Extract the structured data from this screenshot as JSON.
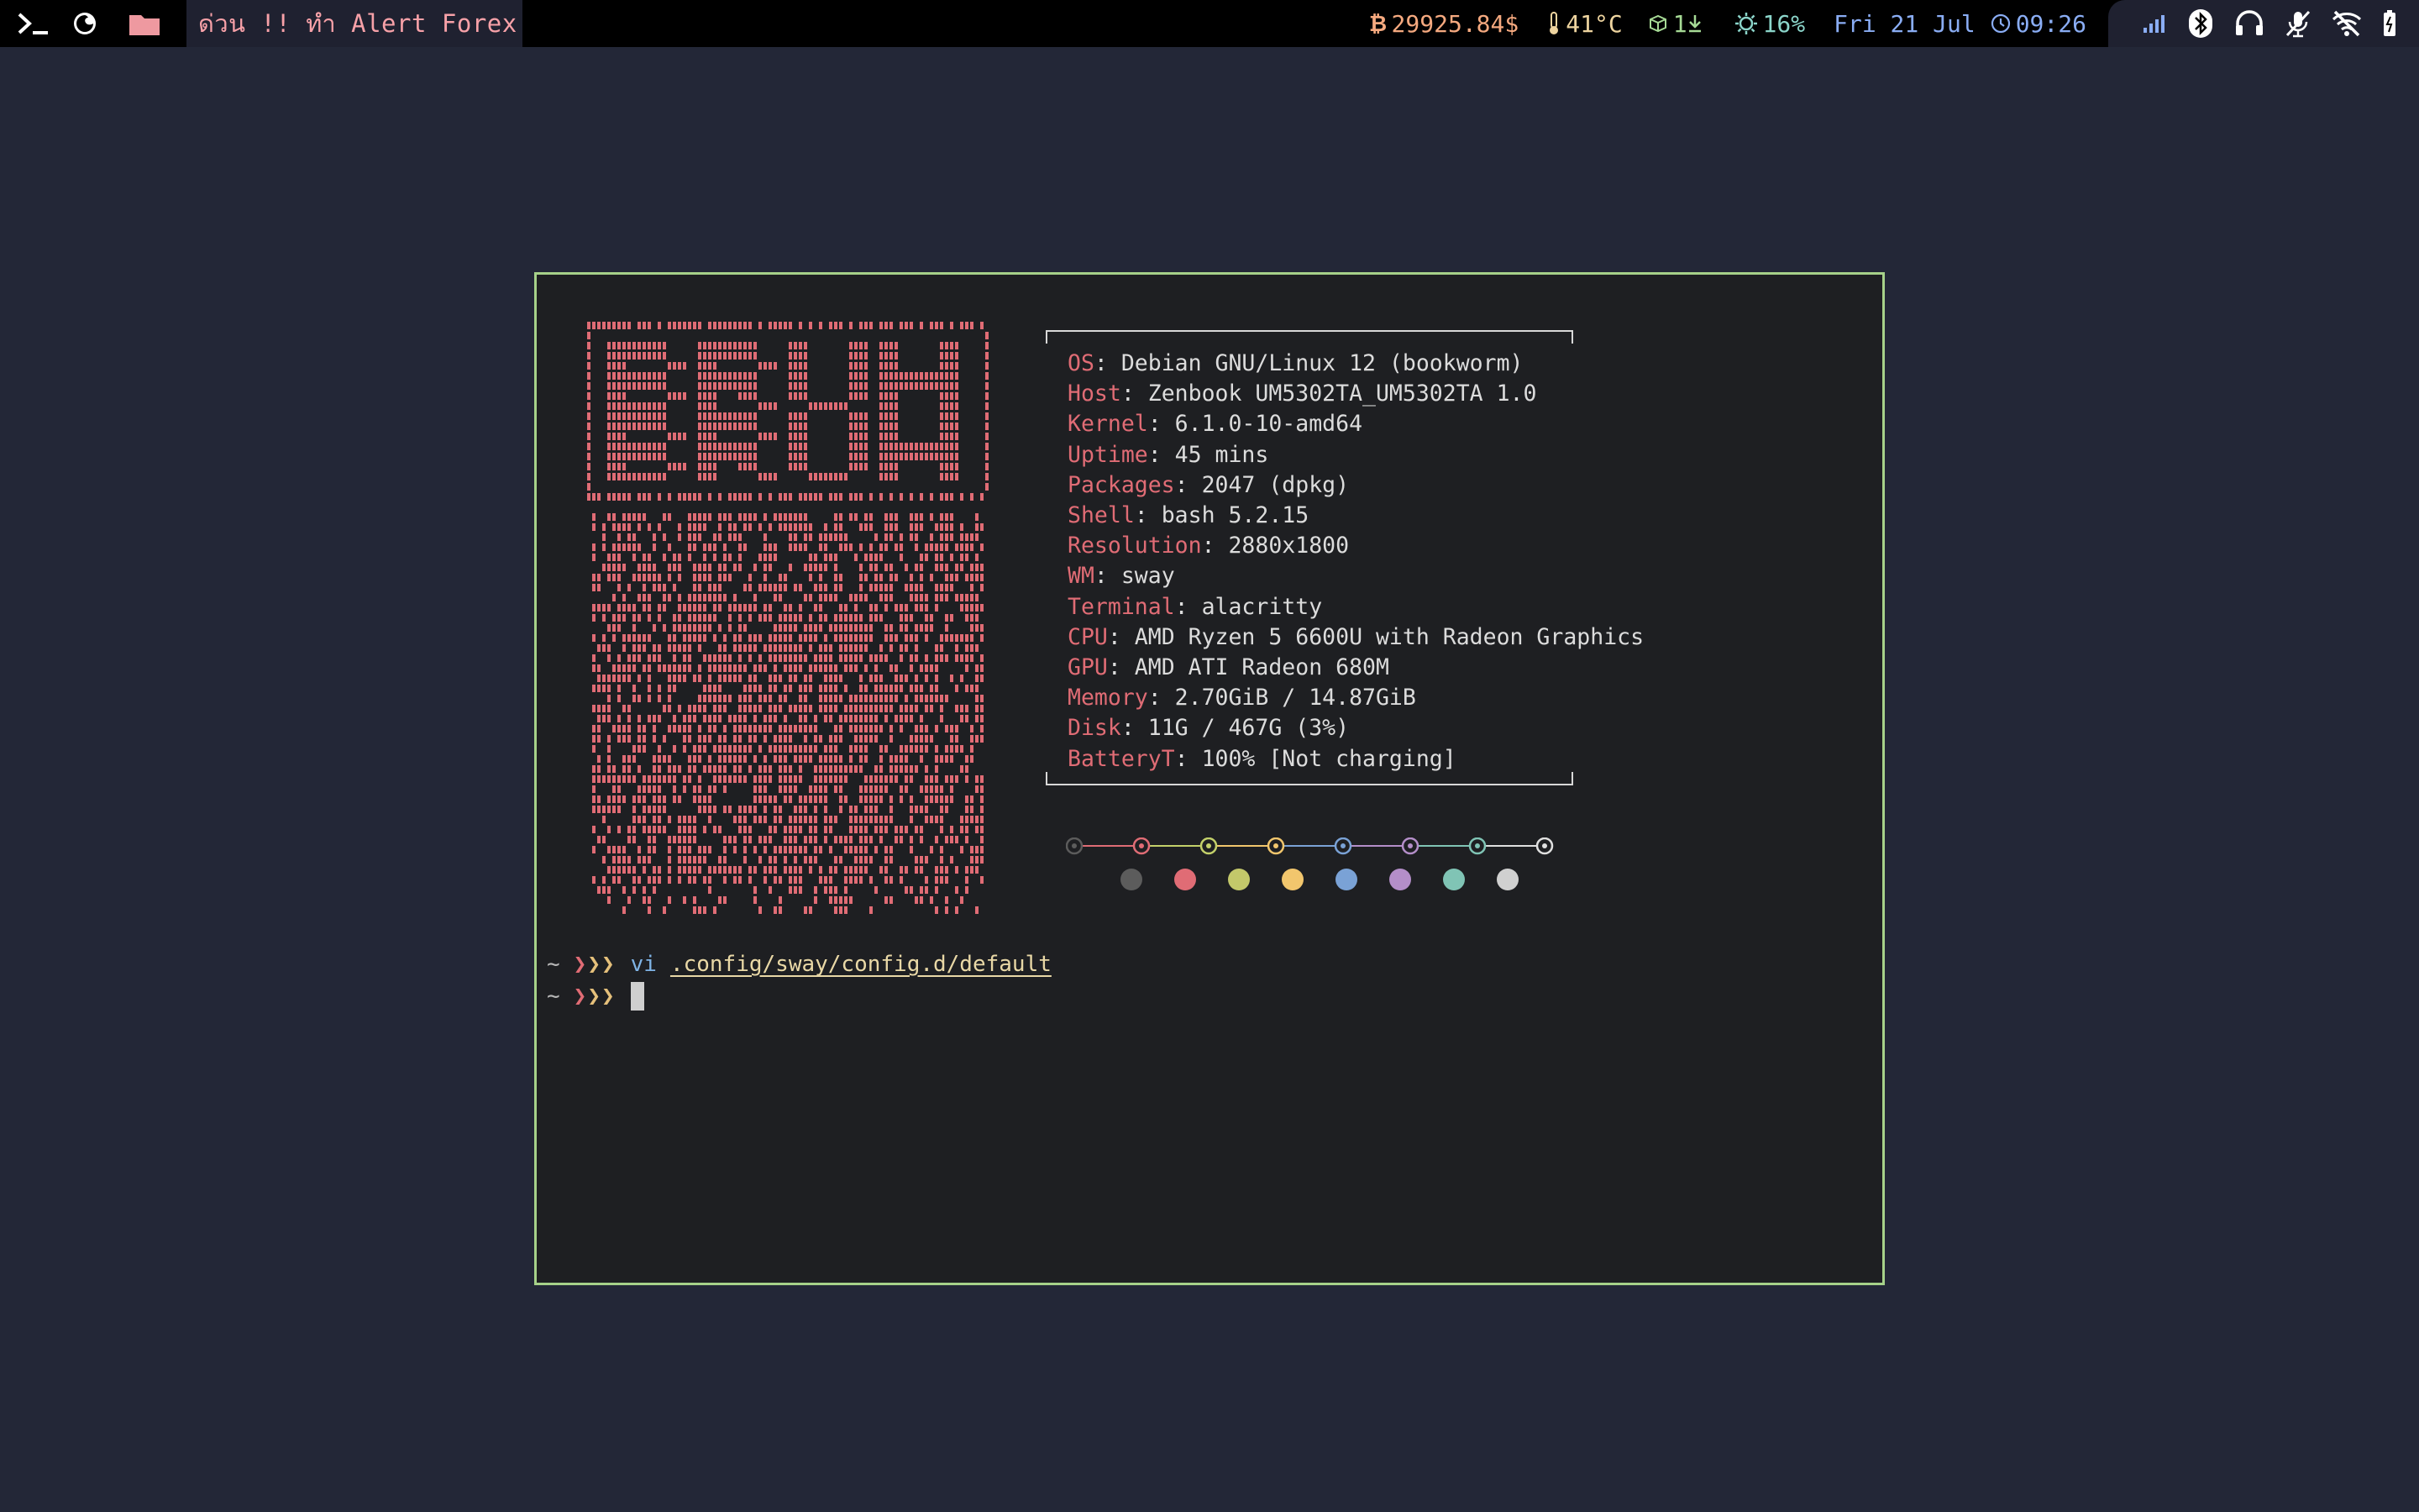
{
  "topbar": {
    "window_title": "ด่วน !! ทำ Alert Forex",
    "btc": "29925.84$",
    "temp": "41°C",
    "updates": "1",
    "brightness": "16%",
    "date": "Fri 21 Jul",
    "time": "09:26",
    "icons": [
      "terminal-icon",
      "firefox-icon",
      "folder-icon",
      "bitcoin-icon",
      "thermometer-icon",
      "package-icon",
      "download-icon",
      "sun-icon",
      "clock-icon",
      "network-signal-icon",
      "bluetooth-icon",
      "headphones-icon",
      "mic-muted-icon",
      "wifi-off-icon",
      "battery-icon"
    ],
    "colors": {
      "btc": "#f5a97f",
      "temp": "#eed49f",
      "updates": "#a6da95",
      "brightness": "#8bd5ca",
      "date": "#8aadf4",
      "title": "#f7a1a8",
      "folder": "#ee99a0"
    }
  },
  "terminal": {
    "border_color": "#a6d189",
    "logo_text": "BRUH",
    "info": [
      {
        "key": "OS",
        "value": "Debian GNU/Linux 12 (bookworm)"
      },
      {
        "key": "Host",
        "value": "Zenbook UM5302TA_UM5302TA 1.0"
      },
      {
        "key": "Kernel",
        "value": "6.1.0-10-amd64"
      },
      {
        "key": "Uptime",
        "value": "45 mins"
      },
      {
        "key": "Packages",
        "value": "2047 (dpkg)"
      },
      {
        "key": "Shell",
        "value": "bash 5.2.15"
      },
      {
        "key": "Resolution",
        "value": "2880x1800"
      },
      {
        "key": "WM",
        "value": "sway"
      },
      {
        "key": "Terminal",
        "value": "alacritty"
      },
      {
        "key": "CPU",
        "value": "AMD Ryzen 5 6600U with Radeon Graphics"
      },
      {
        "key": "GPU",
        "value": "AMD ATI Radeon 680M"
      },
      {
        "key": "Memory",
        "value": "2.70GiB / 14.87GiB"
      },
      {
        "key": "Disk",
        "value": "11G / 467G (3%)"
      },
      {
        "key": "BatteryT",
        "value": "100% [Not charging]"
      }
    ],
    "palette_top": [
      "#5c5c5c",
      "#e06c75",
      "#c3d06a",
      "#f2c66d",
      "#7aa2d6",
      "#b48ec9",
      "#80c4b5",
      "#e0e0e0"
    ],
    "palette_bottom": [
      "#5c5c5c",
      "#e06c75",
      "#c3c86a",
      "#f2c66d",
      "#7aa2d6",
      "#b48ec9",
      "#80c4b5",
      "#d0d0d0"
    ],
    "prompt1": {
      "tilde": "~",
      "arrows": "❯❯❯",
      "command": "vi",
      "arg": ".config/sway/config.d/default"
    },
    "prompt2": {
      "tilde": "~",
      "arrows": "❯❯❯"
    }
  }
}
